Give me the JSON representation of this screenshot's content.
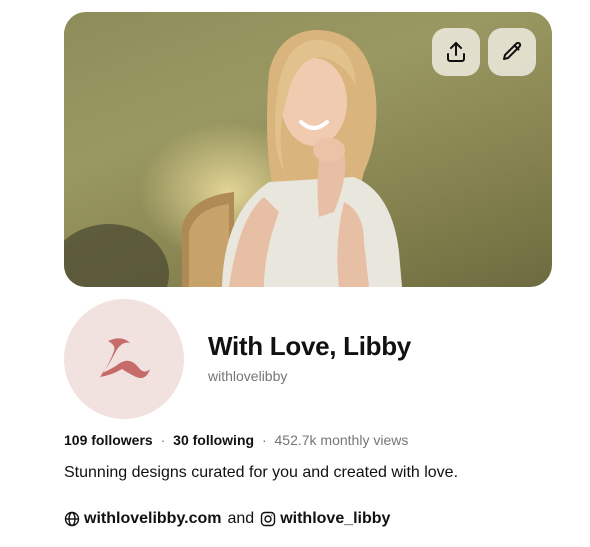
{
  "profile": {
    "name": "With Love, Libby",
    "handle": "withlovelibby",
    "followers": "109 followers",
    "following": "30 following",
    "monthly_views": "452.7k monthly views",
    "stat_separator": "·",
    "bio": "Stunning designs curated for you and created with love."
  },
  "links": {
    "website": "withlovelibby.com",
    "conjunction": "and",
    "instagram": "withlove_libby"
  },
  "cover": {
    "share_icon": "share-upload-icon",
    "edit_icon": "pencil-edit-icon"
  },
  "avatar": {
    "logo": "stylized-L-monogram",
    "background_color": "#f1e1df",
    "logo_color": "#c66a6a"
  },
  "colors": {
    "text_primary": "#111111",
    "text_muted": "#767676",
    "cover_green": "#8e8c5a"
  }
}
